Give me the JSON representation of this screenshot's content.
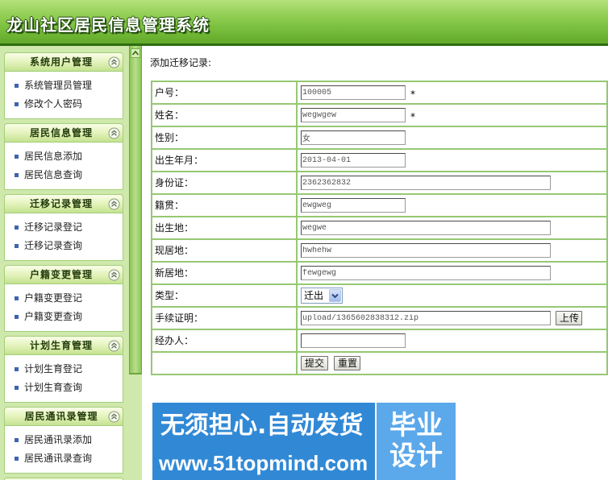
{
  "app": {
    "title": "龙山社区居民信息管理系统"
  },
  "sidebar": {
    "collapse_icon": "chevron-up-icon",
    "bullet_icon": "square-bullet-icon",
    "sections": [
      {
        "title": "系统用户管理",
        "items": [
          "系统管理员管理",
          "修改个人密码"
        ]
      },
      {
        "title": "居民信息管理",
        "items": [
          "居民信息添加",
          "居民信息查询"
        ]
      },
      {
        "title": "迁移记录管理",
        "items": [
          "迁移记录登记",
          "迁移记录查询"
        ]
      },
      {
        "title": "户籍变更管理",
        "items": [
          "户籍变更登记",
          "户籍变更查询"
        ]
      },
      {
        "title": "计划生育管理",
        "items": [
          "计划生育登记",
          "计划生育查询"
        ]
      },
      {
        "title": "居民通讯录管理",
        "items": [
          "居民通讯录添加",
          "居民通讯录查询"
        ]
      }
    ]
  },
  "main": {
    "heading": "添加迁移记录:",
    "form": {
      "required_mark": "*",
      "rows": [
        {
          "label": "户号：",
          "value": "100005"
        },
        {
          "label": "姓名：",
          "value": "wegwgew"
        },
        {
          "label": "性别：",
          "value": "女"
        },
        {
          "label": "出生年月：",
          "value": "2013-04-01"
        },
        {
          "label": "身份证：",
          "value": "2362362832"
        },
        {
          "label": "籍贯：",
          "value": "ewgweg"
        },
        {
          "label": "出生地：",
          "value": "wegwe"
        },
        {
          "label": "现居地：",
          "value": "hwhehw"
        },
        {
          "label": "新居地：",
          "value": "fewgewg"
        },
        {
          "label": "类型：",
          "value": "迁出"
        },
        {
          "label": "手续证明：",
          "value": "upload/1365602838312.zip"
        },
        {
          "label": "经办人：",
          "value": ""
        }
      ],
      "upload_label": "上传",
      "submit_label": "提交",
      "reset_label": "重置"
    }
  },
  "watermark": {
    "line1": "无须担心.自动发货",
    "line2": "www.51topmind.com",
    "badge_top": "毕业",
    "badge_bottom": "设计"
  },
  "colors": {
    "header_green": "#76bc3a",
    "header_line": "#2e6c10",
    "sidebar_bg": "#cfe8ab",
    "table_border_green": "#96c873",
    "watermark_blue": "#3189d6"
  }
}
